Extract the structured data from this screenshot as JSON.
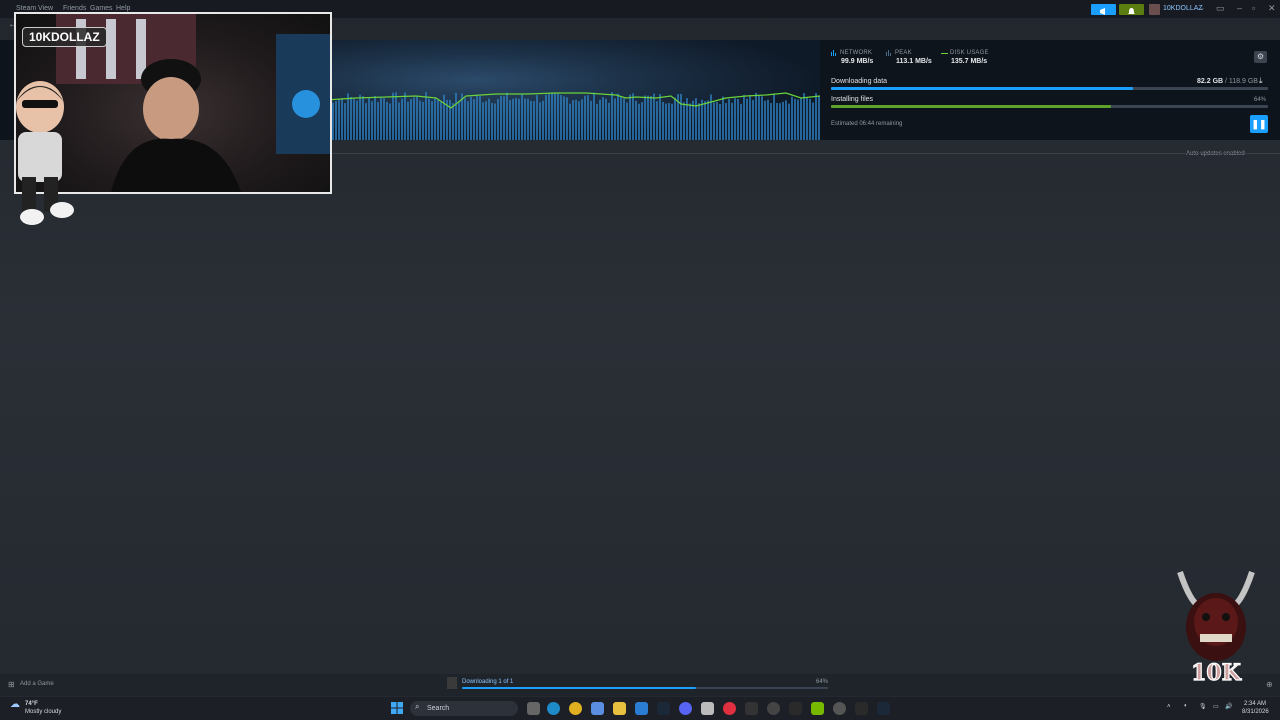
{
  "topbar": {
    "menu": [
      "Steam",
      "View",
      "Friends",
      "Games",
      "Help"
    ],
    "account_name": "10KDOLLAZ"
  },
  "webcam": {
    "name": "10KDOLLAZ"
  },
  "download_stats": {
    "network_label": "NETWORK",
    "network_value": "99.9 MB/s",
    "peak_label": "PEAK",
    "peak_value": "113.1 MB/s",
    "disk_label": "DISK USAGE",
    "disk_value": "135.7 MB/s"
  },
  "progress": {
    "downloading_label": "Downloading data",
    "downloaded": "82.2 GB",
    "total": "/ 118.9 GB",
    "download_fraction": 0.69,
    "installing_label": "Installing files",
    "installing_percent": "64%",
    "install_fraction": 0.64,
    "estimated": "Estimated 06:44 remaining"
  },
  "auto_updates": "Auto-updates enabled",
  "bottombar": {
    "add_game": "Add a Game",
    "status": "Downloading 1 of 1",
    "percent": "64%",
    "fraction": 0.64
  },
  "taskbar": {
    "weather_temp": "74°F",
    "weather_desc": "Mostly cloudy",
    "search": "Search",
    "time": "2:34 AM",
    "date": "8/31/2026"
  },
  "colors": {
    "accent": "#1a9fff",
    "install_green": "#5ba32b",
    "steam_bg": "#171a21"
  }
}
